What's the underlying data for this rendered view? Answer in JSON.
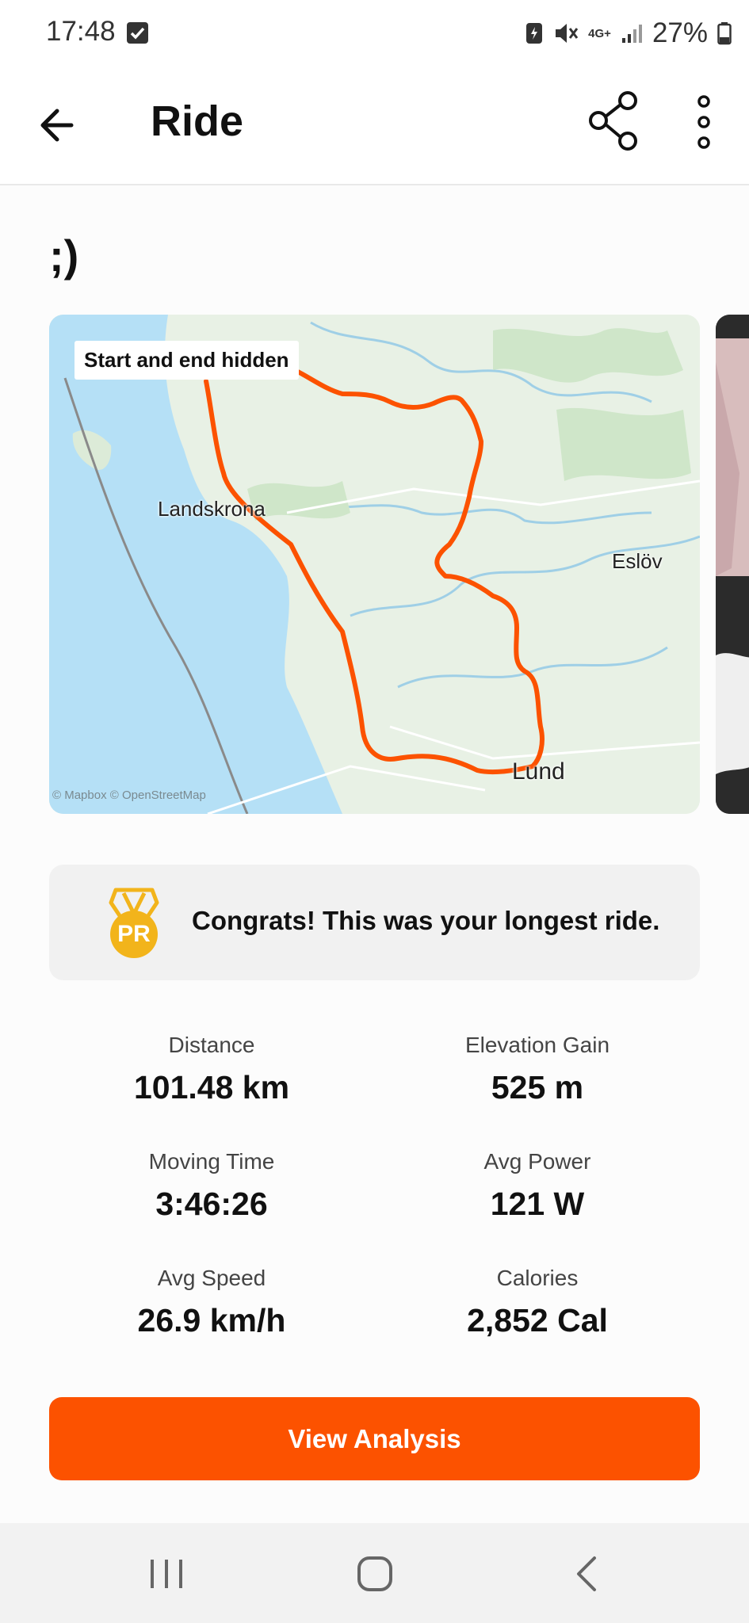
{
  "status": {
    "time": "17:48",
    "network": "4G+",
    "battery": "27%"
  },
  "header": {
    "title": "Ride",
    "back_icon": "arrow-left-icon",
    "share_icon": "share-icon",
    "more_icon": "more-vertical-icon"
  },
  "activity": {
    "title": ";)"
  },
  "map": {
    "privacy_label": "Start and end hidden",
    "towns": [
      "Landskrona",
      "Eslöv",
      "Lund"
    ],
    "attribution": "© Mapbox © OpenStreetMap",
    "route_color": "#fc5200"
  },
  "achievement": {
    "badge_text": "PR",
    "message": "Congrats! This was your longest ride."
  },
  "stats": [
    {
      "label": "Distance",
      "value": "101.48 km"
    },
    {
      "label": "Elevation Gain",
      "value": "525 m"
    },
    {
      "label": "Moving Time",
      "value": "3:46:26"
    },
    {
      "label": "Avg Power",
      "value": "121 W"
    },
    {
      "label": "Avg Speed",
      "value": "26.9 km/h"
    },
    {
      "label": "Calories",
      "value": "2,852 Cal"
    }
  ],
  "actions": {
    "view_analysis": "View Analysis"
  },
  "colors": {
    "accent": "#fc5200",
    "badge": "#f2b41b"
  }
}
